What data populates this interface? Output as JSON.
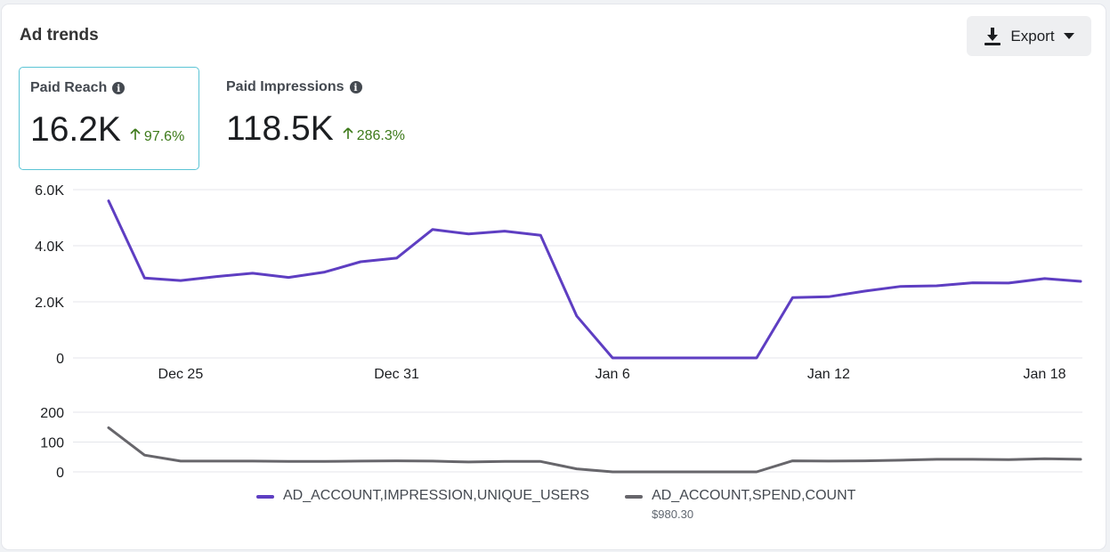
{
  "header": {
    "title": "Ad trends",
    "export_label": "Export",
    "export_icon": "download-icon",
    "caret_icon": "caret-down-icon"
  },
  "metrics": [
    {
      "label": "Paid Reach",
      "value": "16.2K",
      "change": "97.6%",
      "trend": "up",
      "selected": true
    },
    {
      "label": "Paid Impressions",
      "value": "118.5K",
      "change": "286.3%",
      "trend": "up",
      "selected": false
    }
  ],
  "colors": {
    "primary_series": "#5e3ec2",
    "secondary_series": "#67666b",
    "positive": "#3d7a1a",
    "selected_border": "#5bc4d5"
  },
  "legend": [
    {
      "label": "AD_ACCOUNT,IMPRESSION,UNIQUE_USERS",
      "sub": ""
    },
    {
      "label": "AD_ACCOUNT,SPEND,COUNT",
      "sub": "$980.30"
    }
  ],
  "chart_data": [
    {
      "type": "line",
      "x": [
        "Dec 23",
        "Dec 24",
        "Dec 25",
        "Dec 26",
        "Dec 27",
        "Dec 28",
        "Dec 29",
        "Dec 30",
        "Dec 31",
        "Jan 1",
        "Jan 2",
        "Jan 3",
        "Jan 4",
        "Jan 5",
        "Jan 6",
        "Jan 7",
        "Jan 8",
        "Jan 9",
        "Jan 10",
        "Jan 11",
        "Jan 12",
        "Jan 13",
        "Jan 14",
        "Jan 15",
        "Jan 16",
        "Jan 17",
        "Jan 18",
        "Jan 19"
      ],
      "x_tick_labels": [
        "Dec 25",
        "Dec 31",
        "Jan 6",
        "Jan 12",
        "Jan 18"
      ],
      "y_tick_labels": [
        "0",
        "2.0K",
        "4.0K",
        "6.0K"
      ],
      "ylim": [
        0,
        6000
      ],
      "grid": true,
      "series": [
        {
          "name": "AD_ACCOUNT,IMPRESSION,UNIQUE_USERS",
          "values": [
            5600,
            2850,
            2760,
            2900,
            3020,
            2870,
            3060,
            3430,
            3560,
            4580,
            4420,
            4520,
            4370,
            1500,
            0,
            0,
            0,
            0,
            0,
            2150,
            2180,
            2380,
            2550,
            2570,
            2680,
            2670,
            2830,
            2730
          ]
        }
      ]
    },
    {
      "type": "line",
      "x": [
        "Dec 23",
        "Dec 24",
        "Dec 25",
        "Dec 26",
        "Dec 27",
        "Dec 28",
        "Dec 29",
        "Dec 30",
        "Dec 31",
        "Jan 1",
        "Jan 2",
        "Jan 3",
        "Jan 4",
        "Jan 5",
        "Jan 6",
        "Jan 7",
        "Jan 8",
        "Jan 9",
        "Jan 10",
        "Jan 11",
        "Jan 12",
        "Jan 13",
        "Jan 14",
        "Jan 15",
        "Jan 16",
        "Jan 17",
        "Jan 18",
        "Jan 19"
      ],
      "y_tick_labels": [
        "0",
        "100",
        "200"
      ],
      "ylim": [
        0,
        200
      ],
      "grid": true,
      "series": [
        {
          "name": "AD_ACCOUNT,SPEND,COUNT",
          "values": [
            148,
            56,
            36,
            36,
            36,
            35,
            35,
            36,
            37,
            36,
            33,
            35,
            35,
            10,
            0,
            0,
            0,
            0,
            0,
            37,
            36,
            37,
            39,
            42,
            42,
            41,
            44,
            42
          ]
        }
      ]
    }
  ]
}
